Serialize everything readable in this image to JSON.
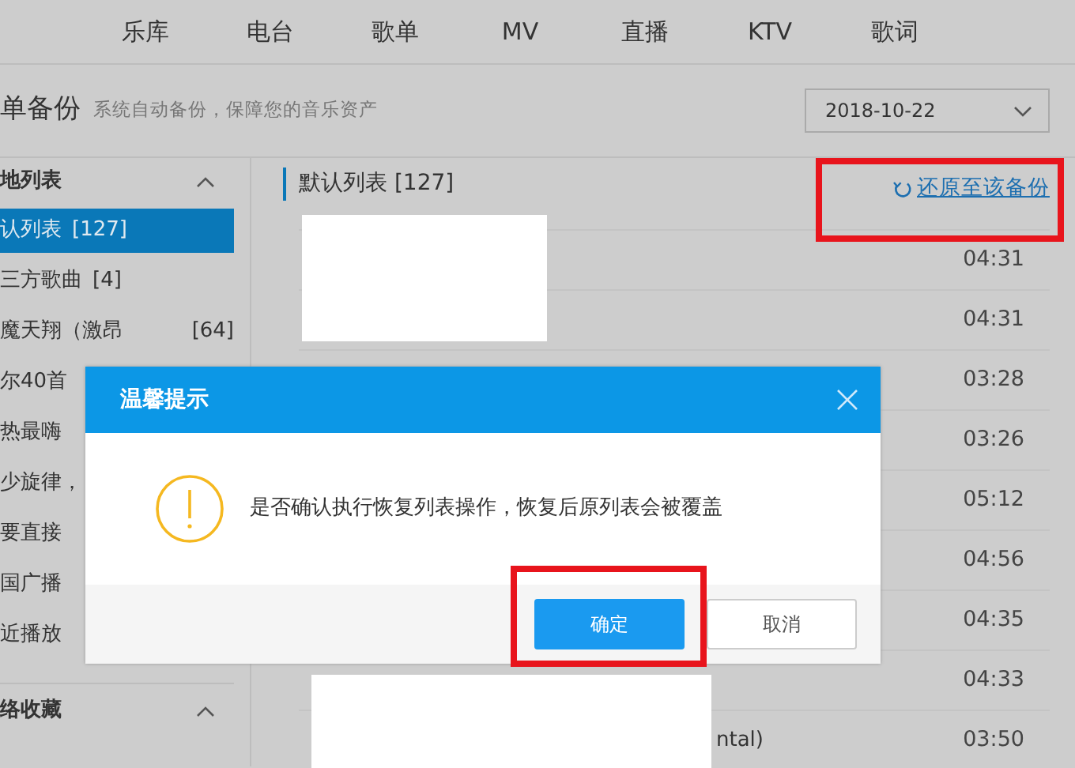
{
  "nav": {
    "items": [
      "乐库",
      "电台",
      "歌单",
      "MV",
      "直播",
      "KTV",
      "歌词"
    ]
  },
  "header": {
    "title": "单备份",
    "subtitle": "系统自动备份，保障您的音乐资产",
    "date_select": {
      "value": "2018-10-22"
    }
  },
  "sidebar": {
    "sections": [
      {
        "title": "地列表",
        "expanded": true,
        "items": [
          {
            "label": "认列表",
            "count": "[127]",
            "selected": true
          },
          {
            "label": "三方歌曲",
            "count": "[4]",
            "selected": false
          },
          {
            "label": "魔天翔（激昂",
            "count": "[64]",
            "selected": false
          },
          {
            "label": "尔40首",
            "selected": false
          },
          {
            "label": "热最嗨",
            "selected": false
          },
          {
            "label": "少旋律，",
            "selected": false
          },
          {
            "label": "要直接",
            "selected": false
          },
          {
            "label": "国广播",
            "selected": false
          },
          {
            "label": "近播放",
            "selected": false
          }
        ]
      },
      {
        "title": "络收藏",
        "expanded": true
      }
    ]
  },
  "list": {
    "title": "默认列表 [127]",
    "restore_link": "还原至该备份",
    "rows": [
      {
        "duration": "04:31"
      },
      {
        "duration": "04:31"
      },
      {
        "duration": "03:28"
      },
      {
        "duration": "03:26"
      },
      {
        "duration": "05:12"
      },
      {
        "duration": "04:56"
      },
      {
        "duration": "04:35"
      },
      {
        "duration": "04:33"
      },
      {
        "title": "ntal)",
        "duration": "03:50"
      }
    ]
  },
  "dialog": {
    "title": "温馨提示",
    "message": "是否确认执行恢复列表操作，恢复后原列表会被覆盖",
    "buttons": [
      {
        "label": "确定",
        "kind": "primary"
      },
      {
        "label": "取消",
        "kind": "secondary"
      }
    ]
  }
}
